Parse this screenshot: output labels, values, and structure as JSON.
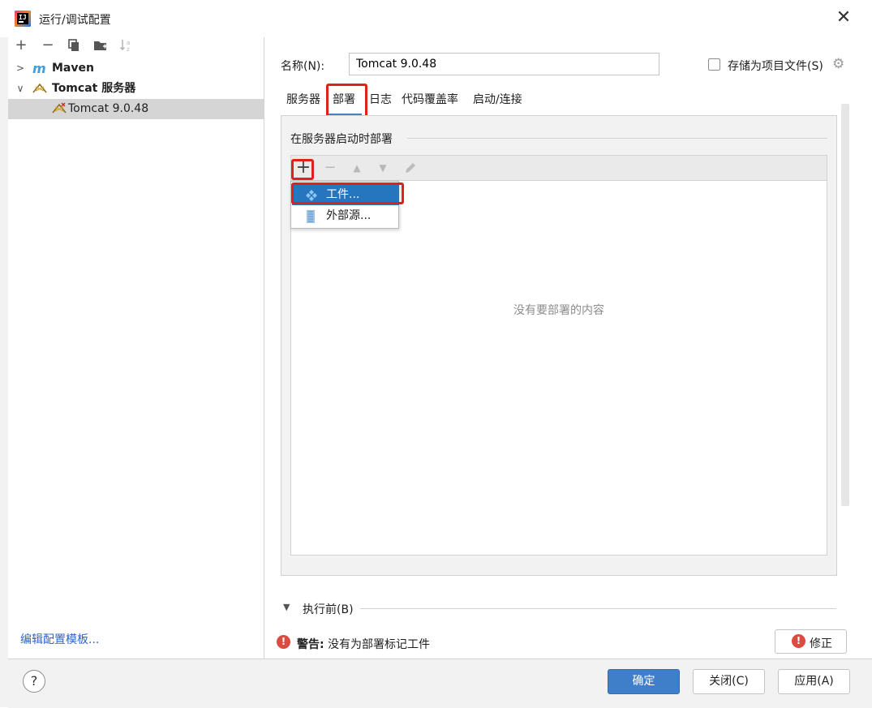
{
  "window": {
    "title": "运行/调试配置",
    "close_glyph": "✕"
  },
  "left_toolbar": {
    "add_icon": "plus-icon",
    "remove_icon": "minus-icon",
    "copy_icon": "copy-icon",
    "folder_icon": "new-folder-icon",
    "sort_icon": "sort-alpha-icon"
  },
  "tree": {
    "items": [
      {
        "label": "Maven",
        "expanded": false,
        "bold": true,
        "icon": "maven-icon"
      },
      {
        "label": "Tomcat 服务器",
        "expanded": true,
        "bold": true,
        "icon": "tomcat-icon"
      },
      {
        "label": "Tomcat 9.0.48",
        "selected": true,
        "icon": "tomcat-config-icon"
      }
    ]
  },
  "edit_templates_link": "编辑配置模板...",
  "name_field": {
    "label": "名称(N):",
    "value": "Tomcat 9.0.48"
  },
  "store_as_project_file": {
    "label": "存储为项目文件(S)",
    "checked": false
  },
  "tabs": [
    {
      "label": "服务器",
      "active": false
    },
    {
      "label": "部署",
      "active": true
    },
    {
      "label": "日志",
      "active": false
    },
    {
      "label": "代码覆盖率",
      "active": false
    },
    {
      "label": "启动/连接",
      "active": false
    }
  ],
  "deploy": {
    "section_title": "在服务器启动时部署",
    "empty_text": "没有要部署的内容",
    "popup": {
      "items": [
        {
          "label": "工件...",
          "highlighted": true,
          "icon": "artifact-icon"
        },
        {
          "label": "外部源...",
          "highlighted": false,
          "icon": "external-source-icon"
        }
      ]
    }
  },
  "before_run": {
    "label": "执行前(B)"
  },
  "warning": {
    "prefix": "警告:",
    "message": "没有为部署标记工件"
  },
  "fix_button": {
    "label": "修正"
  },
  "buttons": {
    "ok": "确定",
    "close": "关闭(C)",
    "apply": "应用(A)",
    "help": "?"
  },
  "colors": {
    "accent": "#3f7fc9",
    "highlight": "#2675bf",
    "annotation_red": "#e0201c",
    "warning_red": "#db4b3f",
    "link": "#2f65ca"
  }
}
